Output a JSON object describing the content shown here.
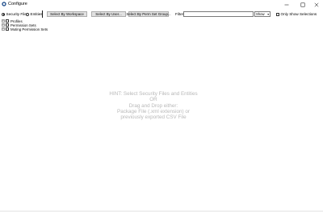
{
  "window": {
    "title": "Configure",
    "icon": "app-icon",
    "controls": [
      "minimize-icon",
      "maximize-icon",
      "close-icon"
    ]
  },
  "toolbar": {
    "radio_security_files": "Security Files",
    "radio_entities": "Entities",
    "selected_radio": "Security Files",
    "select_by_workspace": "Select By Workspace",
    "select_by_user": "Select By User...",
    "select_by_perm_set_group": "Select By Perm Set Group...",
    "filter_label": "Filter:",
    "filter_value": "",
    "show_select_value": "Show",
    "only_show_selections_label": "Only Show Selections",
    "only_show_selections_checked": false
  },
  "tree": {
    "items": [
      {
        "label": "Profiles",
        "expander": "+"
      },
      {
        "label": "Permission Sets",
        "expander": "+"
      },
      {
        "label": "Muting Permission Sets",
        "expander": "+"
      }
    ]
  },
  "hint": {
    "line1": "HINT: Select Security Files and Entities",
    "line2": "OR",
    "line3": "Drag and Drop either:",
    "line4": "Package File (.xml extension) or",
    "line5": "previously exported CSV File"
  },
  "colors": {
    "hint_text": "#b8b8b8",
    "button_bg": "#e1e1e1",
    "button_border": "#adadad"
  }
}
